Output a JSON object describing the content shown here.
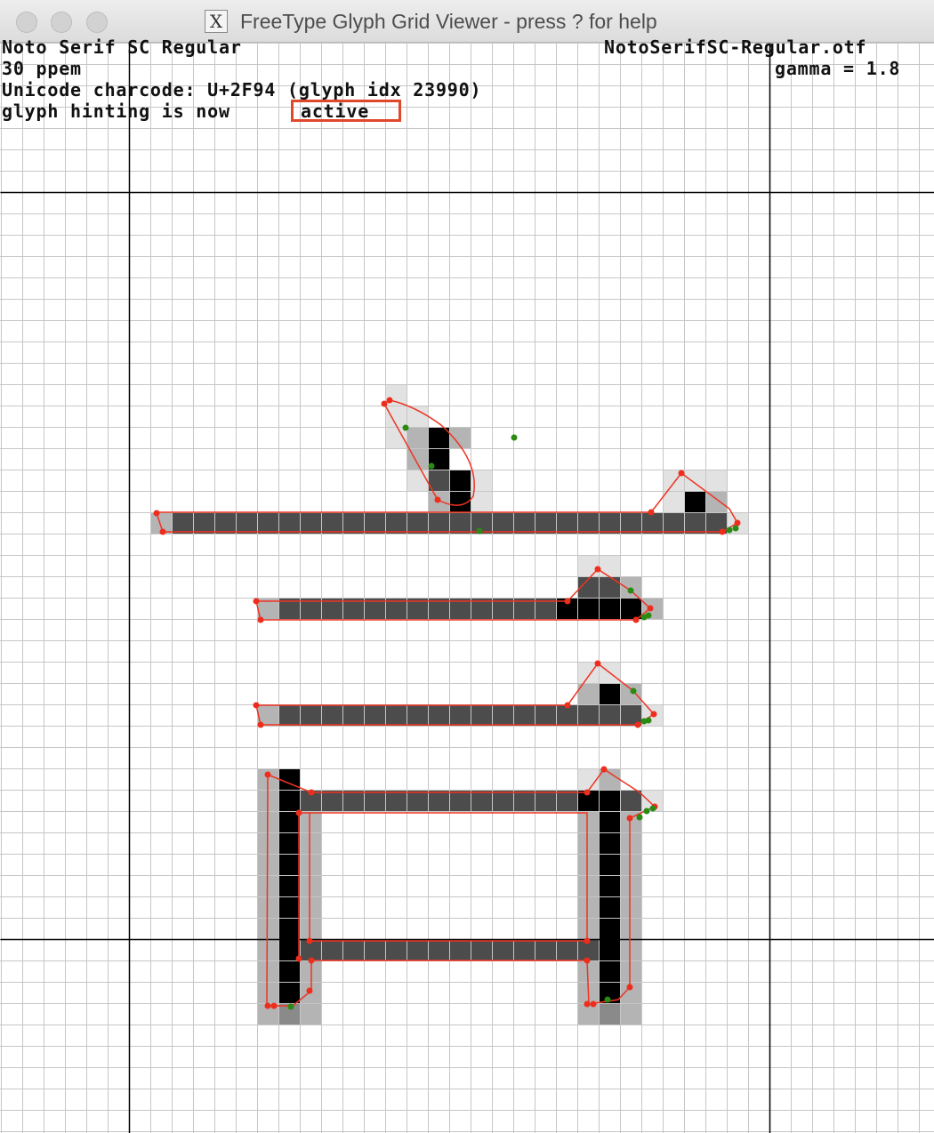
{
  "window": {
    "title": "FreeType Glyph Grid Viewer - press ? for help",
    "app_icon": "x11-icon",
    "buttons": [
      "close",
      "minimize",
      "zoom"
    ]
  },
  "info": {
    "font_name": "Noto Serif SC Regular",
    "file_name": "NotoSerifSC-Regular.otf",
    "ppem": "30 ppem",
    "gamma": "gamma = 1.8",
    "charcode_line": "Unicode charcode: U+2F94 (glyph idx 23990)",
    "hinting_prefix": "glyph hinting is now",
    "hinting_state": "active"
  },
  "colors": {
    "grid_line": "#c6c6c6",
    "axis_line": "#000000",
    "outline": "#ee3322",
    "on_point": "#ee2d1c",
    "off_point": "#2a8a12",
    "highlight": "#e0482c"
  }
}
